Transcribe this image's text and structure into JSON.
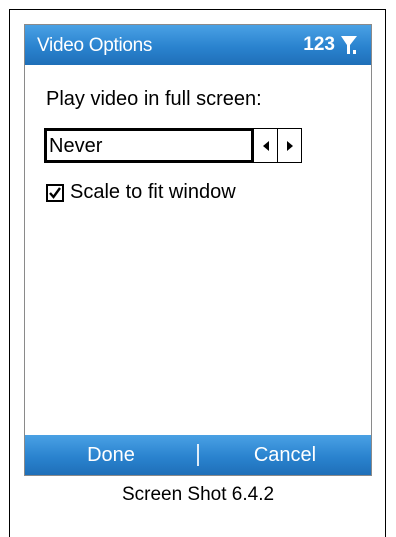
{
  "window": {
    "title": "Video Options",
    "status_text": "123",
    "signal_icon": "signal-antenna-icon"
  },
  "form": {
    "fullscreen_label": "Play video in full screen:",
    "fullscreen_value": "Never",
    "scale_label": "Scale to fit window",
    "scale_checked": true
  },
  "softkeys": {
    "left": "Done",
    "right": "Cancel"
  },
  "caption": "Screen Shot 6.4.2",
  "colors": {
    "bar_blue": "#2a83cf",
    "text": "#000000",
    "bar_text": "#ffffff"
  }
}
